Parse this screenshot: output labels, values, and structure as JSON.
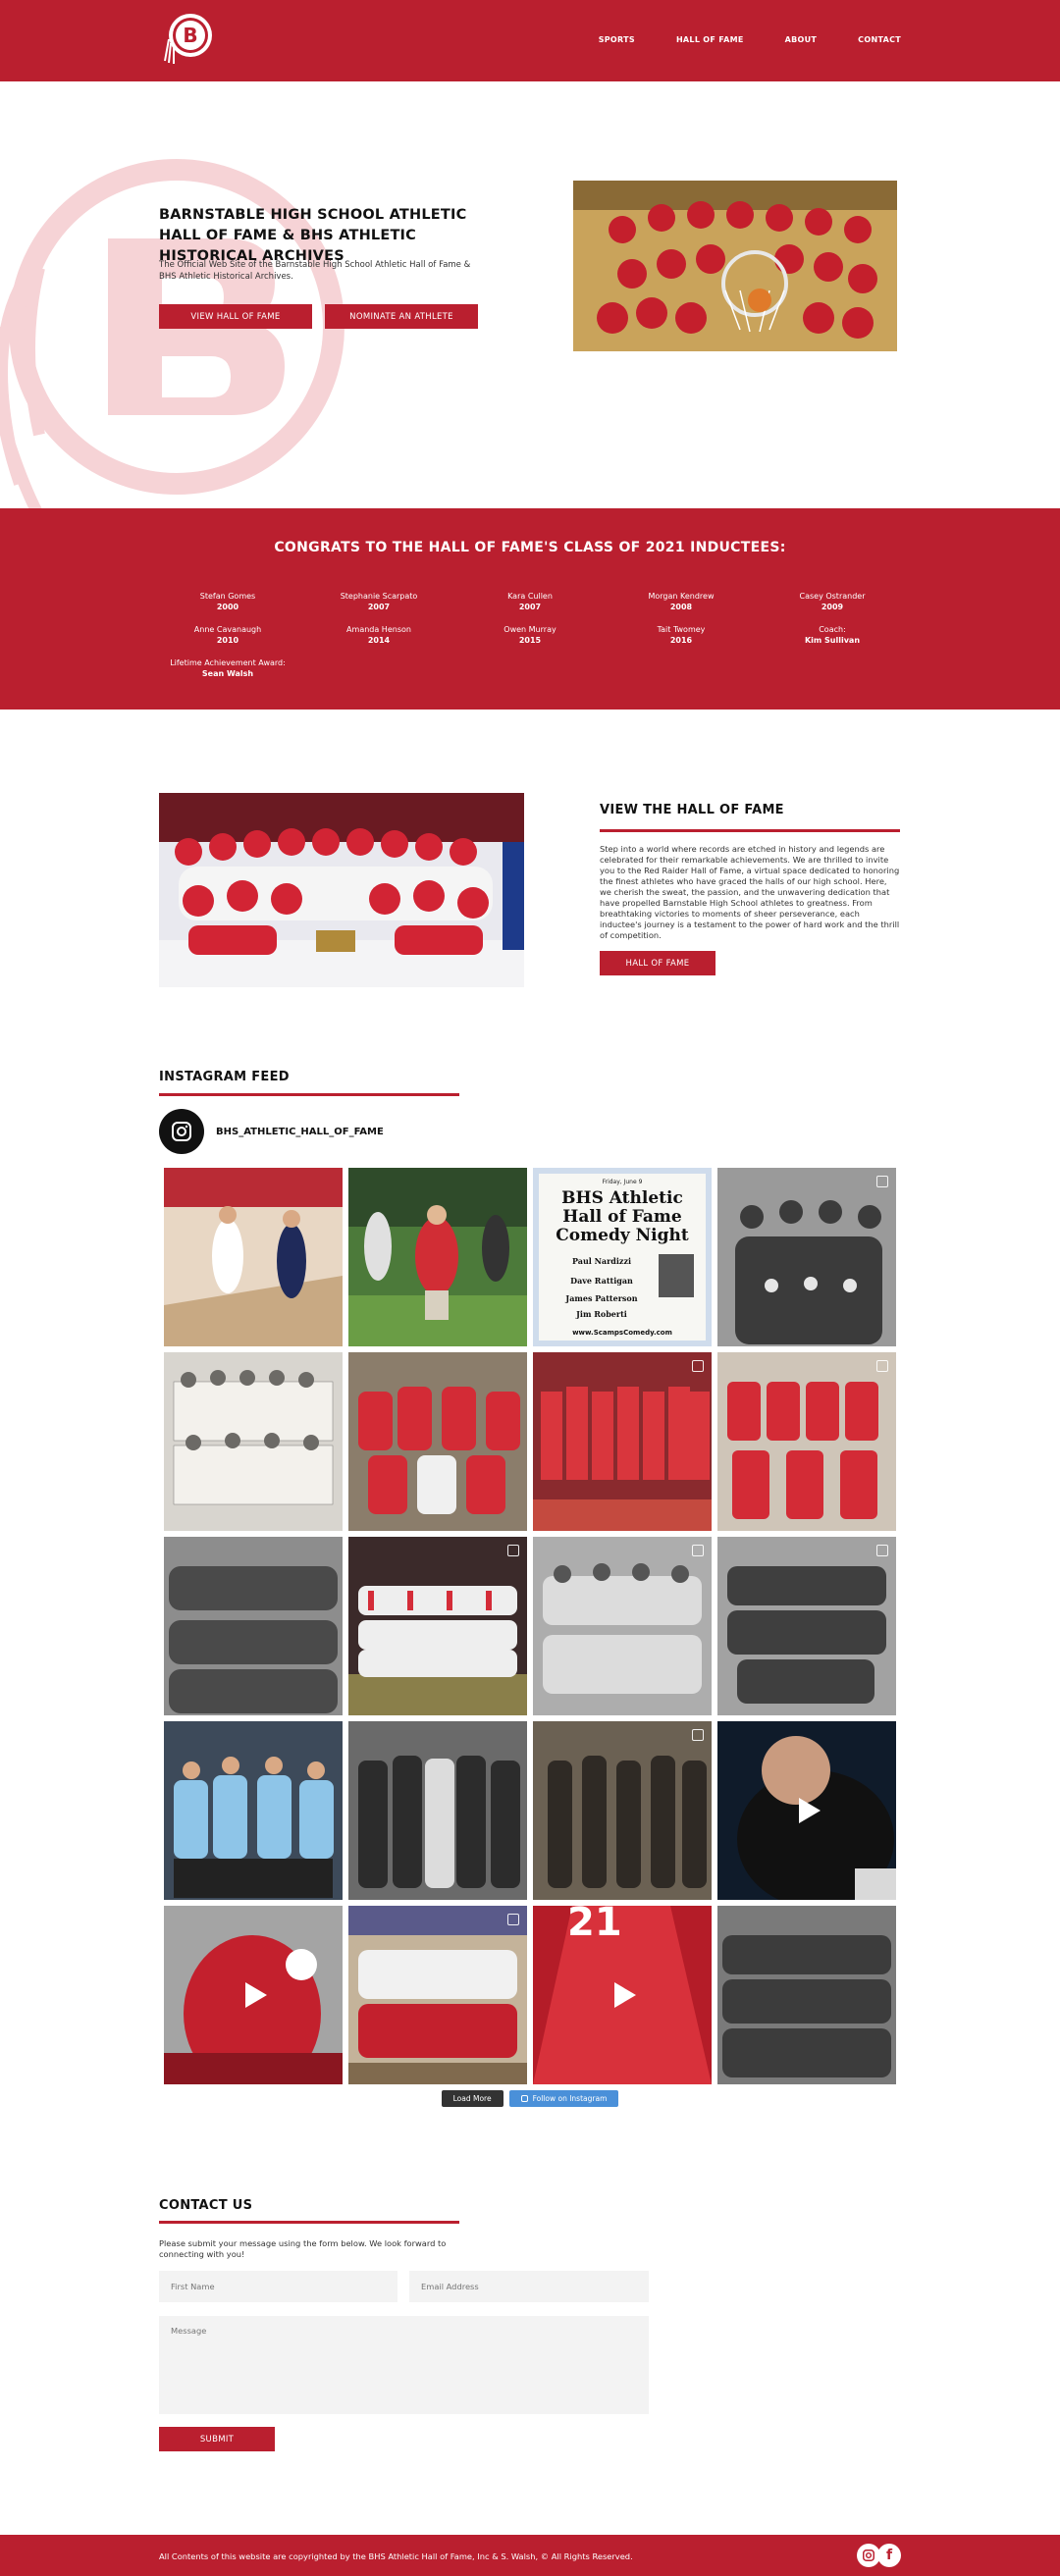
{
  "brand": {
    "red": "#ba1f2f",
    "dark": "#111111",
    "instagram_blue": "#4a90d9"
  },
  "header": {
    "logo_icon": "bhs-raider-logo-icon",
    "logo_letter": "B",
    "nav": [
      "SPORTS",
      "HALL OF FAME",
      "ABOUT",
      "CONTACT"
    ]
  },
  "hero": {
    "title": "BARNSTABLE HIGH SCHOOL ATHLETIC HALL OF FAME & BHS ATHLETIC HISTORICAL ARCHIVES",
    "subtitle": "The Official Web Site of the Barnstable High School Athletic Hall of Fame & BHS Athletic Historical Archives.",
    "btn_view": "VIEW HALL OF FAME",
    "btn_nominate": "NOMINATE AN ATHLETE"
  },
  "inductees": {
    "title": "CONGRATS TO THE HALL OF FAME'S CLASS OF 2021 INDUCTEES:",
    "people": [
      {
        "name": "Stefan Gomes",
        "year": "2000"
      },
      {
        "name": "Stephanie Scarpato",
        "year": "2007"
      },
      {
        "name": "Kara Cullen",
        "year": "2007"
      },
      {
        "name": "Morgan Kendrew",
        "year": "2008"
      },
      {
        "name": "Casey Ostrander",
        "year": "2009"
      },
      {
        "name": "Anne Cavanaugh",
        "year": "2010"
      },
      {
        "name": "Amanda Henson",
        "year": "2014"
      },
      {
        "name": "Owen Murray",
        "year": "2015"
      },
      {
        "name": "Tait Twomey",
        "year": "2016"
      },
      {
        "name": "Coach:",
        "year": "Kim Sullivan"
      },
      {
        "name": "Lifetime Achievement Award:",
        "year": "Sean Walsh"
      }
    ]
  },
  "view_hof": {
    "heading": "VIEW THE HALL OF FAME",
    "text": "Step into a world where records are etched in history and legends are celebrated for their remarkable achievements. We are thrilled to invite you to the Red Raider Hall of Fame, a virtual space dedicated to honoring the finest athletes who have graced the halls of our high school. Here, we cherish the sweat, the passion, and the unwavering dedication that have propelled Barnstable High School athletes to greatness. From breathtaking victories to moments of sheer perseverance, each inductee's journey is a testament to the power of hard work and the thrill of competition.",
    "button": "HALL OF FAME"
  },
  "instagram": {
    "heading": "INSTAGRAM FEED",
    "handle": "BHS_ATHLETIC_HALL_OF_FAME",
    "poster": {
      "date": "Friday, June 9",
      "title_line1": "BHS Athletic",
      "title_line2": "Hall of Fame",
      "title_line3": "Comedy Night",
      "names": [
        "Paul Nardizzi",
        "Dave Rattigan",
        "James Patterson",
        "Jim Roberti"
      ],
      "url": "www.ScampsComedy.com"
    },
    "load_more": "Load More",
    "follow": "Follow on Instagram"
  },
  "contact": {
    "heading": "CONTACT US",
    "text": "Please submit your message using the form below. We look forward to connecting with you!",
    "first_name_placeholder": "First Name",
    "email_placeholder": "Email Address",
    "message_placeholder": "Message",
    "submit": "SUBMIT"
  },
  "footer": {
    "text": "All Contents of this website are copyrighted by the BHS Athletic Hall of Fame, Inc & S. Walsh, © All Rights Reserved."
  }
}
